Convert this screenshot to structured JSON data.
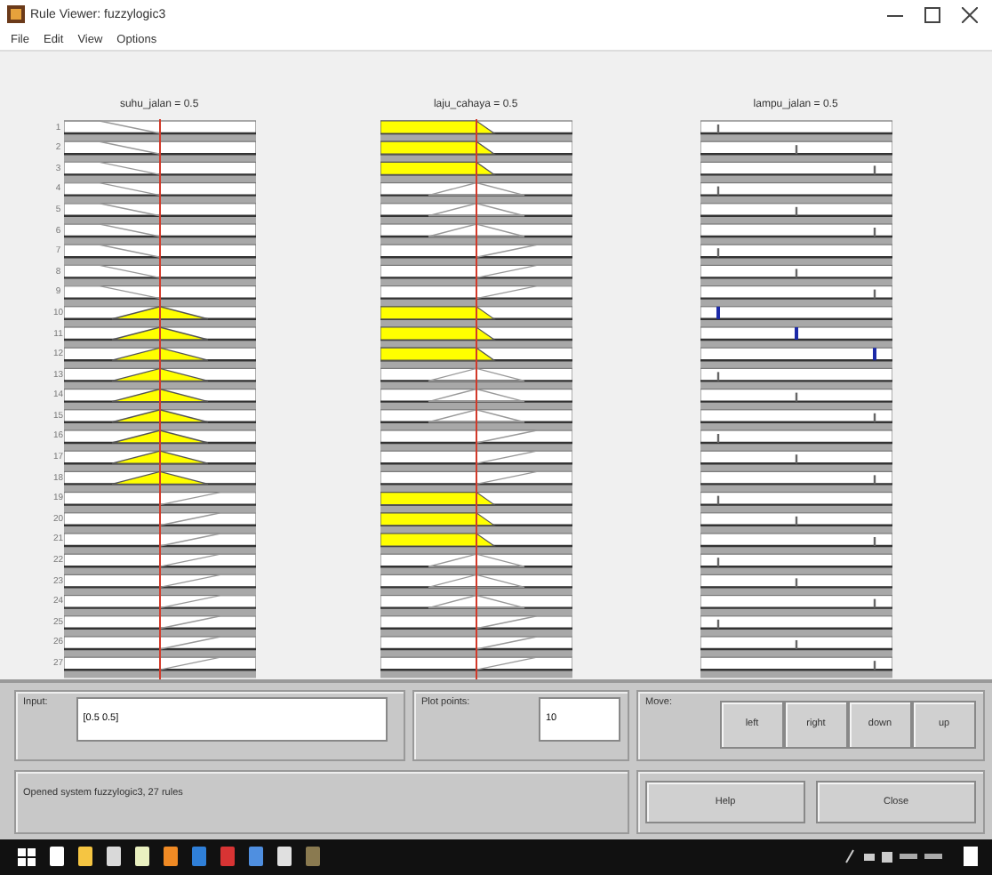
{
  "window": {
    "title": "Rule Viewer: fuzzylogic3"
  },
  "menu": [
    "File",
    "Edit",
    "View",
    "Options"
  ],
  "columns": [
    {
      "title": "suhu_jalan = 0.5",
      "kind": "input"
    },
    {
      "title": "laju_cahaya = 0.5",
      "kind": "input"
    },
    {
      "title": "lampu_jalan = 0.5",
      "kind": "output"
    }
  ],
  "rules": [
    {
      "label": "1",
      "mfs": [
        {
          "kind": "low",
          "fired": false
        },
        {
          "kind": "low",
          "fired": true
        },
        {
          "kind": "low",
          "fired": false
        }
      ]
    },
    {
      "label": "2",
      "mfs": [
        {
          "kind": "low",
          "fired": false
        },
        {
          "kind": "low",
          "fired": true
        },
        {
          "kind": "mid",
          "fired": false
        }
      ]
    },
    {
      "label": "3",
      "mfs": [
        {
          "kind": "low",
          "fired": false
        },
        {
          "kind": "low",
          "fired": true
        },
        {
          "kind": "high",
          "fired": false
        }
      ]
    },
    {
      "label": "4",
      "mfs": [
        {
          "kind": "low",
          "fired": false
        },
        {
          "kind": "mid",
          "fired": false
        },
        {
          "kind": "low",
          "fired": false
        }
      ]
    },
    {
      "label": "5",
      "mfs": [
        {
          "kind": "low",
          "fired": false
        },
        {
          "kind": "mid",
          "fired": false
        },
        {
          "kind": "mid",
          "fired": false
        }
      ]
    },
    {
      "label": "6",
      "mfs": [
        {
          "kind": "low",
          "fired": false
        },
        {
          "kind": "mid",
          "fired": false
        },
        {
          "kind": "high",
          "fired": false
        }
      ]
    },
    {
      "label": "7",
      "mfs": [
        {
          "kind": "low",
          "fired": false
        },
        {
          "kind": "high",
          "fired": false
        },
        {
          "kind": "low",
          "fired": false
        }
      ]
    },
    {
      "label": "8",
      "mfs": [
        {
          "kind": "low",
          "fired": false
        },
        {
          "kind": "high",
          "fired": false
        },
        {
          "kind": "mid",
          "fired": false
        }
      ]
    },
    {
      "label": "9",
      "mfs": [
        {
          "kind": "low",
          "fired": false
        },
        {
          "kind": "high",
          "fired": false
        },
        {
          "kind": "high",
          "fired": false
        }
      ]
    },
    {
      "label": "10",
      "mfs": [
        {
          "kind": "mid",
          "fired": true
        },
        {
          "kind": "low",
          "fired": true
        },
        {
          "kind": "low",
          "fired": true
        }
      ]
    },
    {
      "label": "11",
      "mfs": [
        {
          "kind": "mid",
          "fired": true
        },
        {
          "kind": "low",
          "fired": true
        },
        {
          "kind": "mid",
          "fired": true
        }
      ]
    },
    {
      "label": "12",
      "mfs": [
        {
          "kind": "mid",
          "fired": true
        },
        {
          "kind": "low",
          "fired": true
        },
        {
          "kind": "high",
          "fired": true
        }
      ]
    },
    {
      "label": "13",
      "mfs": [
        {
          "kind": "mid",
          "fired": true
        },
        {
          "kind": "mid",
          "fired": false
        },
        {
          "kind": "low",
          "fired": false
        }
      ]
    },
    {
      "label": "14",
      "mfs": [
        {
          "kind": "mid",
          "fired": true
        },
        {
          "kind": "mid",
          "fired": false
        },
        {
          "kind": "mid",
          "fired": false
        }
      ]
    },
    {
      "label": "15",
      "mfs": [
        {
          "kind": "mid",
          "fired": true
        },
        {
          "kind": "mid",
          "fired": false
        },
        {
          "kind": "high",
          "fired": false
        }
      ]
    },
    {
      "label": "16",
      "mfs": [
        {
          "kind": "mid",
          "fired": true
        },
        {
          "kind": "high",
          "fired": false
        },
        {
          "kind": "low",
          "fired": false
        }
      ]
    },
    {
      "label": "17",
      "mfs": [
        {
          "kind": "mid",
          "fired": true
        },
        {
          "kind": "high",
          "fired": false
        },
        {
          "kind": "mid",
          "fired": false
        }
      ]
    },
    {
      "label": "18",
      "mfs": [
        {
          "kind": "mid",
          "fired": true
        },
        {
          "kind": "high",
          "fired": false
        },
        {
          "kind": "high",
          "fired": false
        }
      ]
    },
    {
      "label": "19",
      "mfs": [
        {
          "kind": "high",
          "fired": false
        },
        {
          "kind": "low",
          "fired": true
        },
        {
          "kind": "low",
          "fired": false
        }
      ]
    },
    {
      "label": "20",
      "mfs": [
        {
          "kind": "high",
          "fired": false
        },
        {
          "kind": "low",
          "fired": true
        },
        {
          "kind": "mid",
          "fired": false
        }
      ]
    },
    {
      "label": "21",
      "mfs": [
        {
          "kind": "high",
          "fired": false
        },
        {
          "kind": "low",
          "fired": true
        },
        {
          "kind": "high",
          "fired": false
        }
      ]
    },
    {
      "label": "22",
      "mfs": [
        {
          "kind": "high",
          "fired": false
        },
        {
          "kind": "mid",
          "fired": false
        },
        {
          "kind": "low",
          "fired": false
        }
      ]
    },
    {
      "label": "23",
      "mfs": [
        {
          "kind": "high",
          "fired": false
        },
        {
          "kind": "mid",
          "fired": false
        },
        {
          "kind": "mid",
          "fired": false
        }
      ]
    },
    {
      "label": "24",
      "mfs": [
        {
          "kind": "high",
          "fired": false
        },
        {
          "kind": "mid",
          "fired": false
        },
        {
          "kind": "high",
          "fired": false
        }
      ]
    },
    {
      "label": "25",
      "mfs": [
        {
          "kind": "high",
          "fired": false
        },
        {
          "kind": "high",
          "fired": false
        },
        {
          "kind": "low",
          "fired": false
        }
      ]
    },
    {
      "label": "26",
      "mfs": [
        {
          "kind": "high",
          "fired": false
        },
        {
          "kind": "high",
          "fired": false
        },
        {
          "kind": "mid",
          "fired": false
        }
      ]
    },
    {
      "label": "27",
      "mfs": [
        {
          "kind": "high",
          "fired": false
        },
        {
          "kind": "high",
          "fired": false
        },
        {
          "kind": "high",
          "fired": false
        }
      ]
    }
  ],
  "input_panel": {
    "label": "Input:",
    "value": "[0.5 0.5]"
  },
  "plot_points": {
    "label": "Plot points:",
    "value": "10"
  },
  "move": {
    "label": "Move:",
    "buttons": [
      "left",
      "right",
      "down",
      "up"
    ]
  },
  "status": "Opened system fuzzylogic3, 27 rules",
  "buttons": [
    "Help",
    "Close"
  ]
}
